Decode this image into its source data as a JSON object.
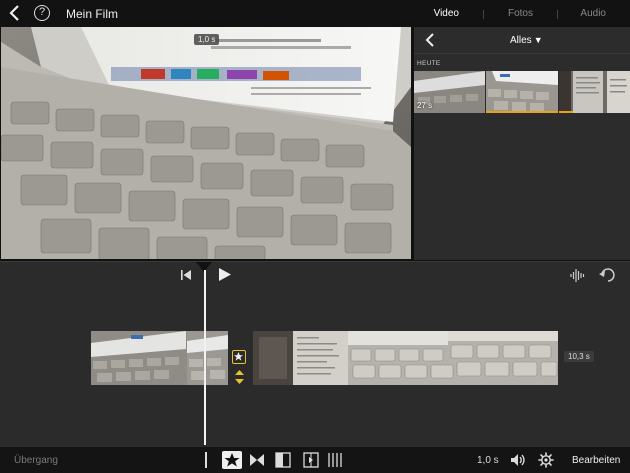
{
  "topbar": {
    "title": "Mein Film",
    "help_label": "?",
    "tabs": [
      {
        "label": "Video",
        "active": true
      },
      {
        "label": "Fotos",
        "active": false
      },
      {
        "label": "Audio",
        "active": false
      }
    ]
  },
  "viewer": {
    "clip_duration": "1,0 s"
  },
  "browser": {
    "filter_label": "Alles",
    "section_label": "HEUTE",
    "first_clip_duration": "27 s",
    "used_color": "#e8a317"
  },
  "timeline": {
    "end_duration": "10,3 s",
    "transition_color": "#e8c231"
  },
  "bottombar": {
    "transition_label": "Übergang",
    "speed_value": "1,0 s",
    "edit_label": "Bearbeiten"
  }
}
